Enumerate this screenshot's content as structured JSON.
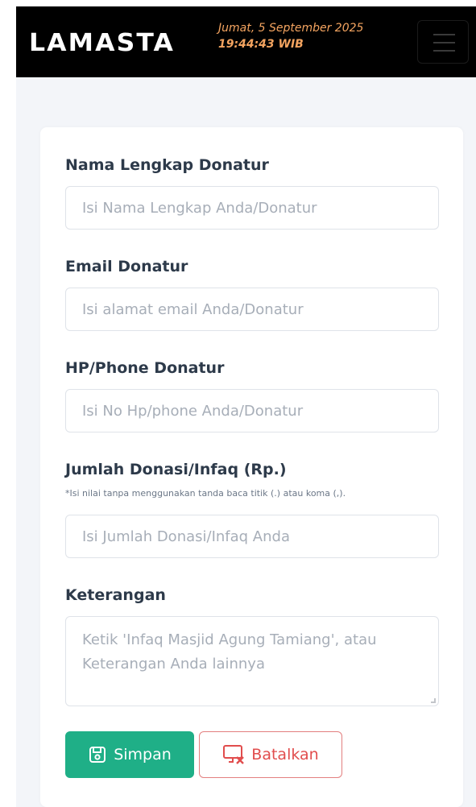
{
  "header": {
    "brand": "LAMASTA",
    "date": "Jumat, 5 September 2025",
    "time": "19:44:43 WIB",
    "menu_icon": "hamburger-menu-icon"
  },
  "form": {
    "fields": [
      {
        "label": "Nama Lengkap Donatur",
        "placeholder": "Isi Nama Lengkap Anda/Donatur",
        "value": ""
      },
      {
        "label": "Email Donatur",
        "placeholder": "Isi alamat email Anda/Donatur",
        "value": ""
      },
      {
        "label": "HP/Phone Donatur",
        "placeholder": "Isi No Hp/phone Anda/Donatur",
        "value": ""
      },
      {
        "label": "Jumlah Donasi/Infaq (Rp.)",
        "hint": "*Isi nilai tanpa menggunakan tanda baca titik (.) atau koma (,).",
        "placeholder": "Isi Jumlah Donasi/Infaq Anda",
        "value": ""
      },
      {
        "label": "Keterangan",
        "placeholder": "Ketik 'Infaq Masjid Agung Tamiang', atau Keterangan Anda lainnya",
        "value": ""
      }
    ],
    "save_label": "Simpan",
    "save_icon": "save-icon",
    "cancel_label": "Batalkan",
    "cancel_icon": "cancel-screen-icon"
  },
  "colors": {
    "header_bg": "#000000",
    "datetime": "#f4a460",
    "save_button": "#1faf87",
    "cancel_button": "#e14d4d",
    "page_bg": "#f3f5f9"
  }
}
